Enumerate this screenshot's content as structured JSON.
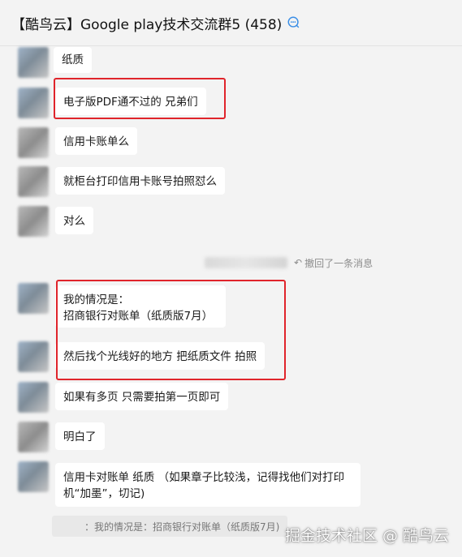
{
  "header": {
    "title": "【酷鸟云】Google play技术交流群5 (458)",
    "icon": "group-chat-icon"
  },
  "messages": [
    {
      "text": "纸质"
    },
    {
      "text": "电子版PDF通不过的 兄弟们"
    },
    {
      "text": "信用卡账单么"
    },
    {
      "text": "就柜台打印信用卡账号拍照怼么"
    },
    {
      "text": "对么"
    },
    {
      "line1": "我的情况是：",
      "line2": "招商银行对账单（纸质版7月）"
    },
    {
      "text": "然后找个光线好的地方 把纸质文件 拍照"
    },
    {
      "text": "如果有多页 只需要拍第一页即可"
    },
    {
      "text": "明白了"
    },
    {
      "text": "信用卡对账单 纸质 （如果章子比较浅，记得找他们对打印机“加墨”，切记)"
    }
  ],
  "recall_notice": "撤回了一条消息",
  "quote_text": "：我的情况是：招商银行对账单（纸质版7月)",
  "watermark": "掘金技术社区 @ 酷鸟云",
  "colors": {
    "highlight": "#e0242b",
    "background": "#f3f3f3",
    "bubble": "#ffffff"
  }
}
